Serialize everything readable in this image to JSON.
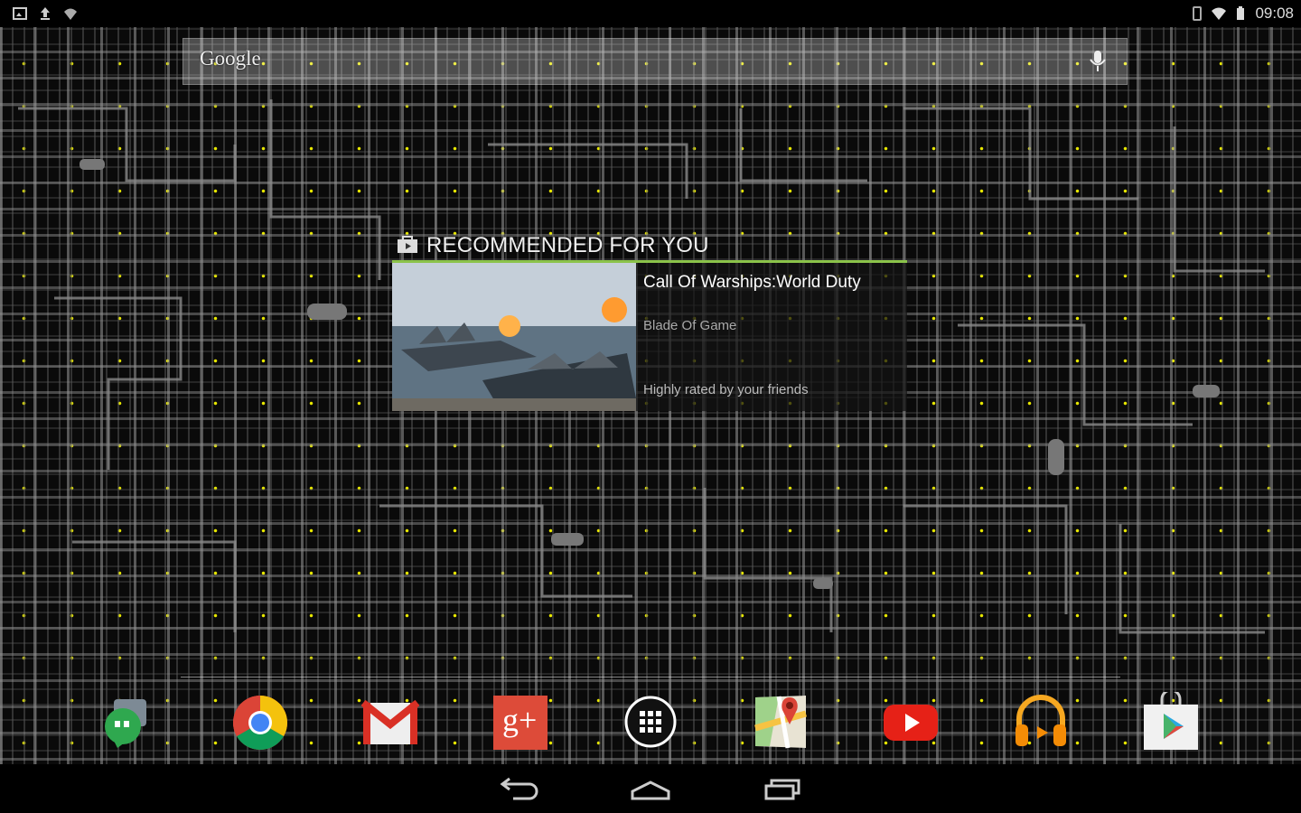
{
  "status_bar": {
    "clock": "09:08",
    "left_icons": [
      "screenshot-icon",
      "upload-icon",
      "wifi-icon"
    ],
    "right_icons": [
      "vibrate-icon",
      "wifi-signal-icon",
      "battery-icon"
    ]
  },
  "search": {
    "logo": "Google",
    "icon": "mic-icon"
  },
  "widget": {
    "header": "RECOMMENDED FOR YOU",
    "accent_color": "#8bc34a",
    "app_title": "Call Of Warships:World Duty",
    "developer": "Blade Of Game",
    "reason": "Highly rated by your friends"
  },
  "dock": {
    "apps": [
      {
        "name": "Hangouts",
        "icon": "hangouts-icon"
      },
      {
        "name": "Chrome",
        "icon": "chrome-icon"
      },
      {
        "name": "Gmail",
        "icon": "gmail-icon"
      },
      {
        "name": "Google+",
        "icon": "google-plus-icon"
      },
      {
        "name": "All apps",
        "icon": "app-drawer-icon"
      },
      {
        "name": "Maps",
        "icon": "maps-icon"
      },
      {
        "name": "YouTube",
        "icon": "youtube-icon"
      },
      {
        "name": "Play Music",
        "icon": "headphones-icon"
      },
      {
        "name": "Play Store",
        "icon": "play-store-icon"
      }
    ],
    "google_plus_label": "g+"
  },
  "nav": {
    "buttons": [
      "back-icon",
      "home-icon",
      "recents-icon"
    ]
  }
}
